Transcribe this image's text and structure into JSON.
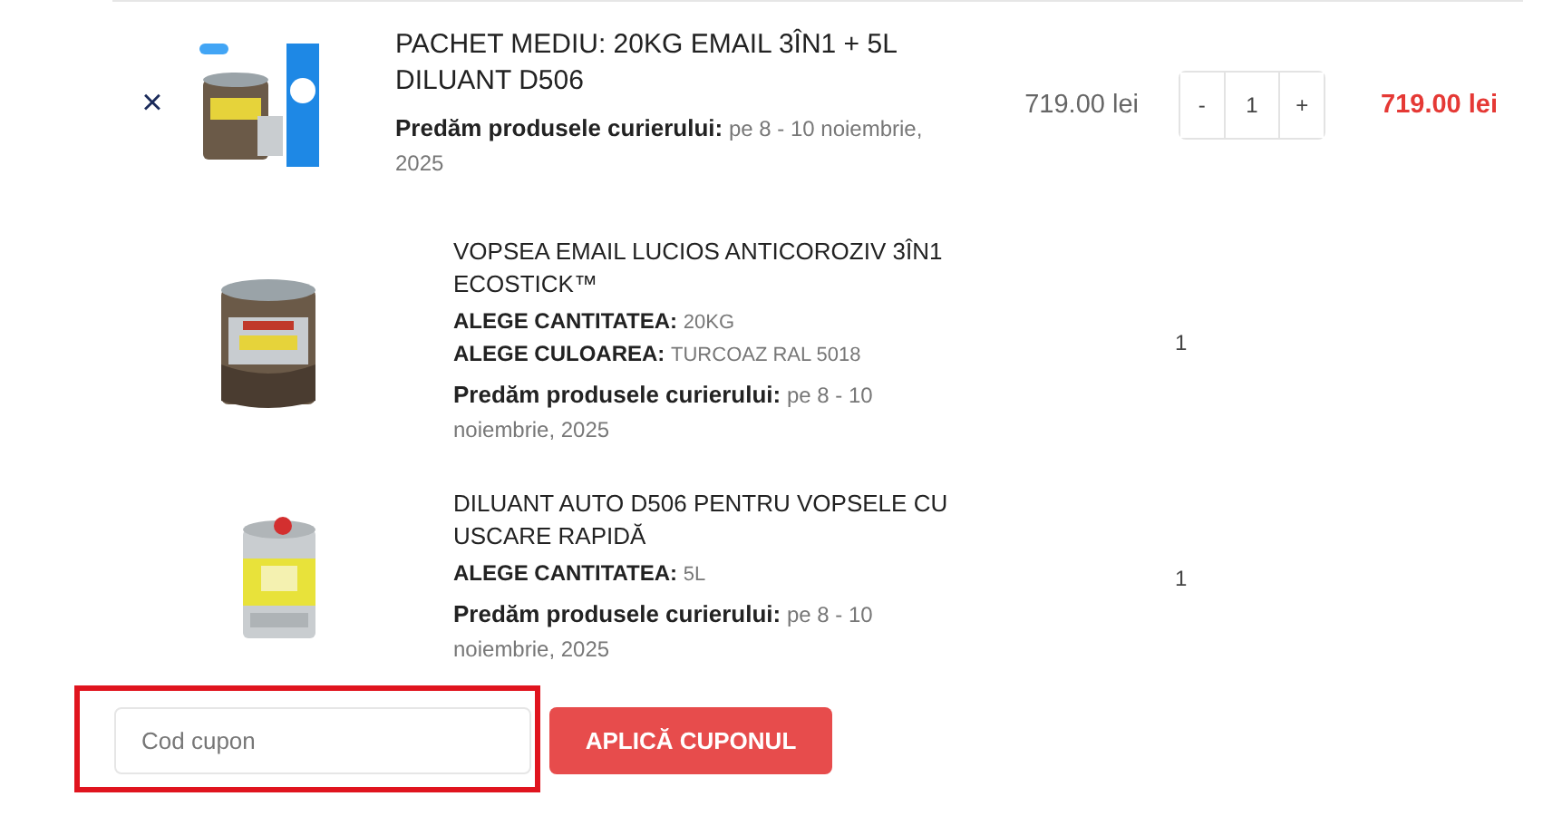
{
  "cart_item": {
    "remove": "×",
    "title": "PACHET MEDIU: 20KG EMAIL 3ÎN1 + 5L DILUANT D506",
    "delivery_label": "Predăm produsele curierului:",
    "delivery_value": "pe 8 - 10 noiembrie, 2025",
    "price": "719.00 lei",
    "quantity": {
      "minus": "-",
      "value": "1",
      "plus": "+"
    },
    "subtotal": "719.00 lei"
  },
  "bundle_items": [
    {
      "title": "VOPSEA EMAIL LUCIOS ANTICOROZIV 3ÎN1 ECOSTICK™",
      "attributes": [
        {
          "label": "ALEGE CANTITATEA:",
          "value": "20KG"
        },
        {
          "label": "ALEGE CULOAREA:",
          "value": "TURCOAZ RAL 5018"
        }
      ],
      "delivery_label": "Predăm produsele curierului:",
      "delivery_value": "pe 8 - 10 noiembrie, 2025",
      "quantity": "1",
      "kind": "bucket"
    },
    {
      "title": "DILUANT AUTO D506 PENTRU VOPSELE CU USCARE RAPIDĂ",
      "attributes": [
        {
          "label": "ALEGE CANTITATEA:",
          "value": "5L"
        }
      ],
      "delivery_label": "Predăm produsele curierului:",
      "delivery_value": "pe 8 - 10 noiembrie, 2025",
      "quantity": "1",
      "kind": "can"
    }
  ],
  "coupon": {
    "placeholder": "Cod cupon",
    "button": "APLICĂ CUPONUL",
    "highlighted": true
  }
}
